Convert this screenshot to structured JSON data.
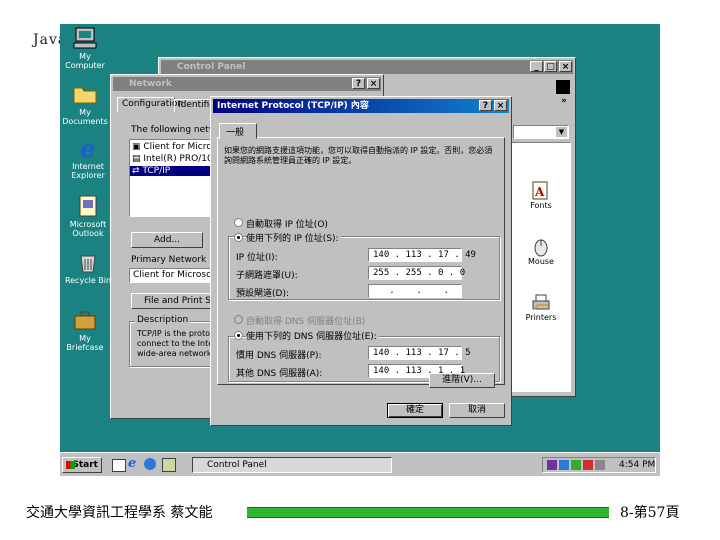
{
  "slide": {
    "header": "Java",
    "footer_left": "交通大學資訊工程學系 蔡文能",
    "footer_right": "8-第57頁",
    "footer_bar_color": "#2fb52f"
  },
  "desktop": {
    "icons": [
      {
        "label": "My Computer",
        "icon": "computer-icon"
      },
      {
        "label": "My Documents",
        "icon": "folder-icon"
      },
      {
        "label": "Internet Explorer",
        "icon": "ie-icon"
      },
      {
        "label": "Microsoft Outlook",
        "icon": "outlook-icon"
      },
      {
        "label": "Recycle Bin",
        "icon": "recycle-bin-icon"
      },
      {
        "label": "My Briefcase",
        "icon": "briefcase-icon"
      }
    ]
  },
  "control_panel": {
    "title": "Control Panel",
    "items": [
      {
        "label": "Fonts",
        "icon": "fonts-icon"
      },
      {
        "label": "Mouse",
        "icon": "mouse-icon"
      },
      {
        "label": "Printers",
        "icon": "printers-icon"
      }
    ],
    "arrows": "»"
  },
  "network": {
    "title": "Network",
    "tabs": [
      "Configuration",
      "Identification"
    ],
    "list_label": "The following network components are installed:",
    "components": [
      "Client for Microsoft Networks",
      "Intel(R) PRO/100",
      "TCP/IP"
    ],
    "add_button": "Add...",
    "primary_logon_label": "Primary Network Logon:",
    "primary_logon_value": "Client for Microsoft Networks",
    "file_print_button": "File and Print Sharing...",
    "description_label": "Description",
    "description_text": "TCP/IP is the protocol you use to connect to the Internet and wide-area networks."
  },
  "tcpip": {
    "title": "Internet Protocol (TCP/IP) 內容",
    "tab": "一般",
    "intro": "如果您的網路支援這項功能，您可以取得自動指派的 IP 設定。否則，您必須詢問網路系統管理員正確的 IP 設定。",
    "auto_ip": "自動取得 IP 位址(O)",
    "manual_ip": "使用下列的 IP 位址(S):",
    "ip_label": "IP 位址(I):",
    "ip_value": "140 . 113 . 17 . 49",
    "mask_label": "子網路遮罩(U):",
    "mask_value": "255 . 255 . 0 . 0",
    "gateway_label": "預設閘道(D):",
    "gateway_value": "   .    .    .",
    "auto_dns": "自動取得 DNS 伺服器位址(B)",
    "manual_dns": "使用下列的 DNS 伺服器位址(E):",
    "dns1_label": "慣用 DNS 伺服器(P):",
    "dns1_value": "140 . 113 . 17 . 5",
    "dns2_label": "其他 DNS 伺服器(A):",
    "dns2_value": "140 . 113 . 1 . 1",
    "advanced_button": "進階(V)...",
    "ok_button": "確定",
    "cancel_button": "取消",
    "help_button": "?",
    "close_button": "×"
  },
  "taskbar": {
    "start_label": "Start",
    "task_label": "Control Panel",
    "clock": "4:54 PM"
  }
}
